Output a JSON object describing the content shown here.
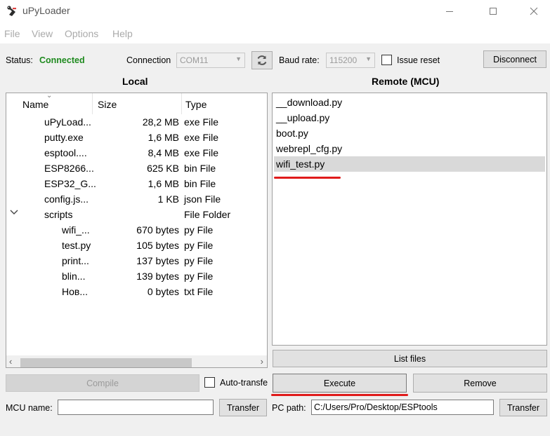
{
  "window": {
    "title": "uPyLoader",
    "icon": "upyloader-snake-icon"
  },
  "menu": [
    "File",
    "View",
    "Options",
    "Help"
  ],
  "toolbar": {
    "status_label": "Status:",
    "status_value": "Connected",
    "connection_label": "Connection",
    "connection_value": "COM11",
    "baud_label": "Baud rate:",
    "baud_value": "115200",
    "issue_reset_label": "Issue reset",
    "disconnect_label": "Disconnect"
  },
  "local": {
    "title": "Local",
    "columns": [
      "Name",
      "Size",
      "Type"
    ],
    "rows": [
      {
        "name": "uPyLoad...",
        "size": "28,2 MB",
        "type": "exe File"
      },
      {
        "name": "putty.exe",
        "size": "1,6 MB",
        "type": "exe File"
      },
      {
        "name": "esptool....",
        "size": "8,4 MB",
        "type": "exe File"
      },
      {
        "name": "ESP8266...",
        "size": "625 KB",
        "type": "bin File"
      },
      {
        "name": "ESP32_G...",
        "size": "1,6 MB",
        "type": "bin File"
      },
      {
        "name": "config.js...",
        "size": "1 KB",
        "type": "json File"
      },
      {
        "name": "scripts",
        "size": "",
        "type": "File Folder"
      },
      {
        "name": "wifi_...",
        "size": "670 bytes",
        "type": "py File"
      },
      {
        "name": "test.py",
        "size": "105 bytes",
        "type": "py File"
      },
      {
        "name": "print...",
        "size": "137 bytes",
        "type": "py File"
      },
      {
        "name": "blin...",
        "size": "139 bytes",
        "type": "py File"
      },
      {
        "name": "Нов...",
        "size": "0 bytes",
        "type": "txt File"
      }
    ],
    "compile_label": "Compile",
    "auto_transfer_label": "Auto-transfer",
    "mcu_name_label": "MCU name:",
    "mcu_name_value": "",
    "transfer_label": "Transfer"
  },
  "remote": {
    "title": "Remote (MCU)",
    "files": [
      "__download.py",
      "__upload.py",
      "boot.py",
      "webrepl_cfg.py",
      "wifi_test.py"
    ],
    "selected_index": 4,
    "list_files_label": "List files",
    "execute_label": "Execute",
    "remove_label": "Remove",
    "pc_path_label": "PC path:",
    "pc_path_value": "C:/Users/Pro/Desktop/ESPtools",
    "transfer_label": "Transfer"
  },
  "colors": {
    "status_connected": "#1e8a1e",
    "annotation_underline": "#e01b1b",
    "selection": "#d9d9d9"
  }
}
